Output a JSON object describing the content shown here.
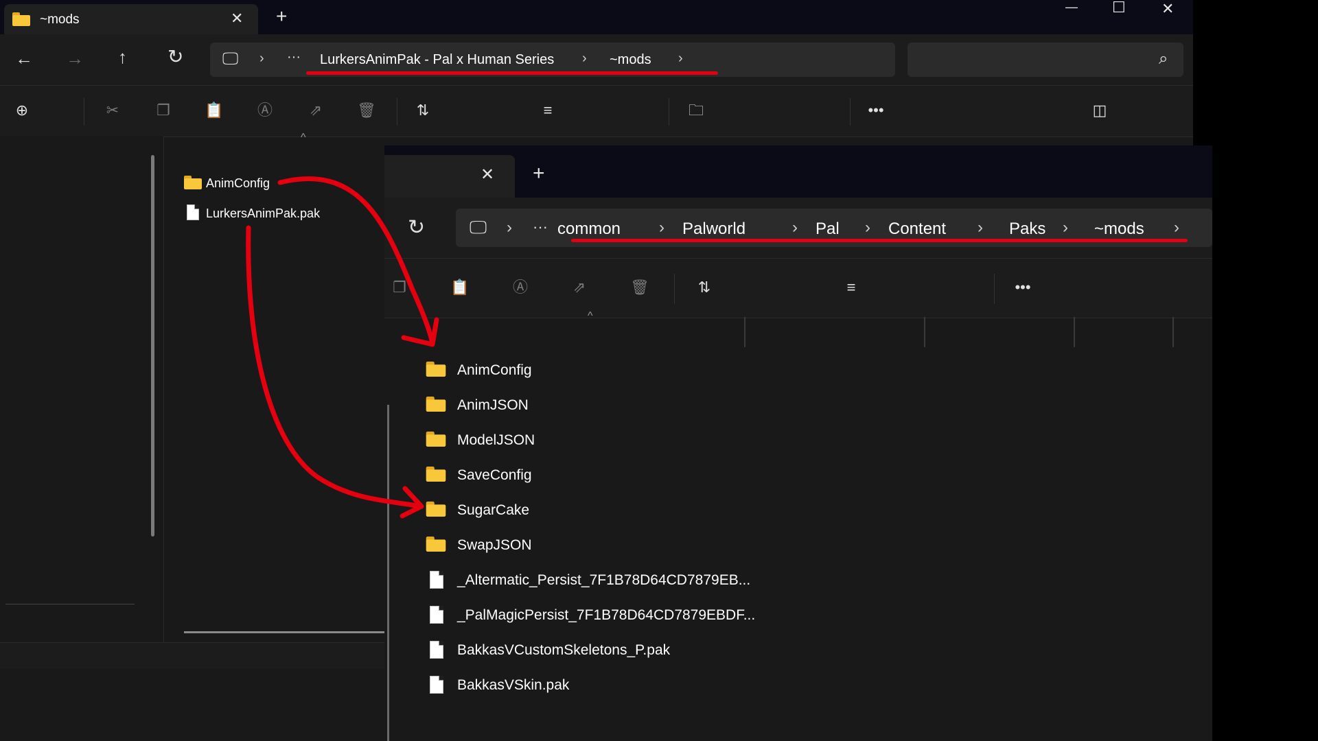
{
  "back_window": {
    "tab_title": "~mods",
    "breadcrumb": [
      "LurkersAnimPak - Pal x Human Series",
      "~mods"
    ],
    "files": [
      {
        "name": "AnimConfig",
        "kind": "folder"
      },
      {
        "name": "LurkersAnimPak.pak",
        "kind": "file"
      }
    ]
  },
  "front_window": {
    "breadcrumb": [
      "common",
      "Palworld",
      "Pal",
      "Content",
      "Paks",
      "~mods"
    ],
    "files": [
      {
        "name": "AnimConfig",
        "kind": "folder"
      },
      {
        "name": "AnimJSON",
        "kind": "folder"
      },
      {
        "name": "ModelJSON",
        "kind": "folder"
      },
      {
        "name": "SaveConfig",
        "kind": "folder"
      },
      {
        "name": "SugarCake",
        "kind": "folder"
      },
      {
        "name": "SwapJSON",
        "kind": "folder"
      },
      {
        "name": "_Altermatic_Persist_7F1B78D64CD7879EB...",
        "kind": "file"
      },
      {
        "name": "_PalMagicPersist_7F1B78D64CD7879EBDF...",
        "kind": "file"
      },
      {
        "name": "BakkasVCustomSkeletons_P.pak",
        "kind": "file"
      },
      {
        "name": "BakkasVSkin.pak",
        "kind": "file"
      }
    ]
  },
  "icons": {
    "close": "✕",
    "plus": "+",
    "back": "←",
    "forward": "→",
    "up": "↑",
    "refresh": "↻",
    "monitor": "🖵",
    "chevron": "›",
    "more": "···",
    "ellipsis": "•••",
    "minimize": "—",
    "maximize": "☐",
    "search": "⌕",
    "sort": "⇅",
    "view": "≡",
    "caret_up": "^"
  },
  "colors": {
    "annotation": "#e4000f",
    "folder": "#f8c83a"
  }
}
